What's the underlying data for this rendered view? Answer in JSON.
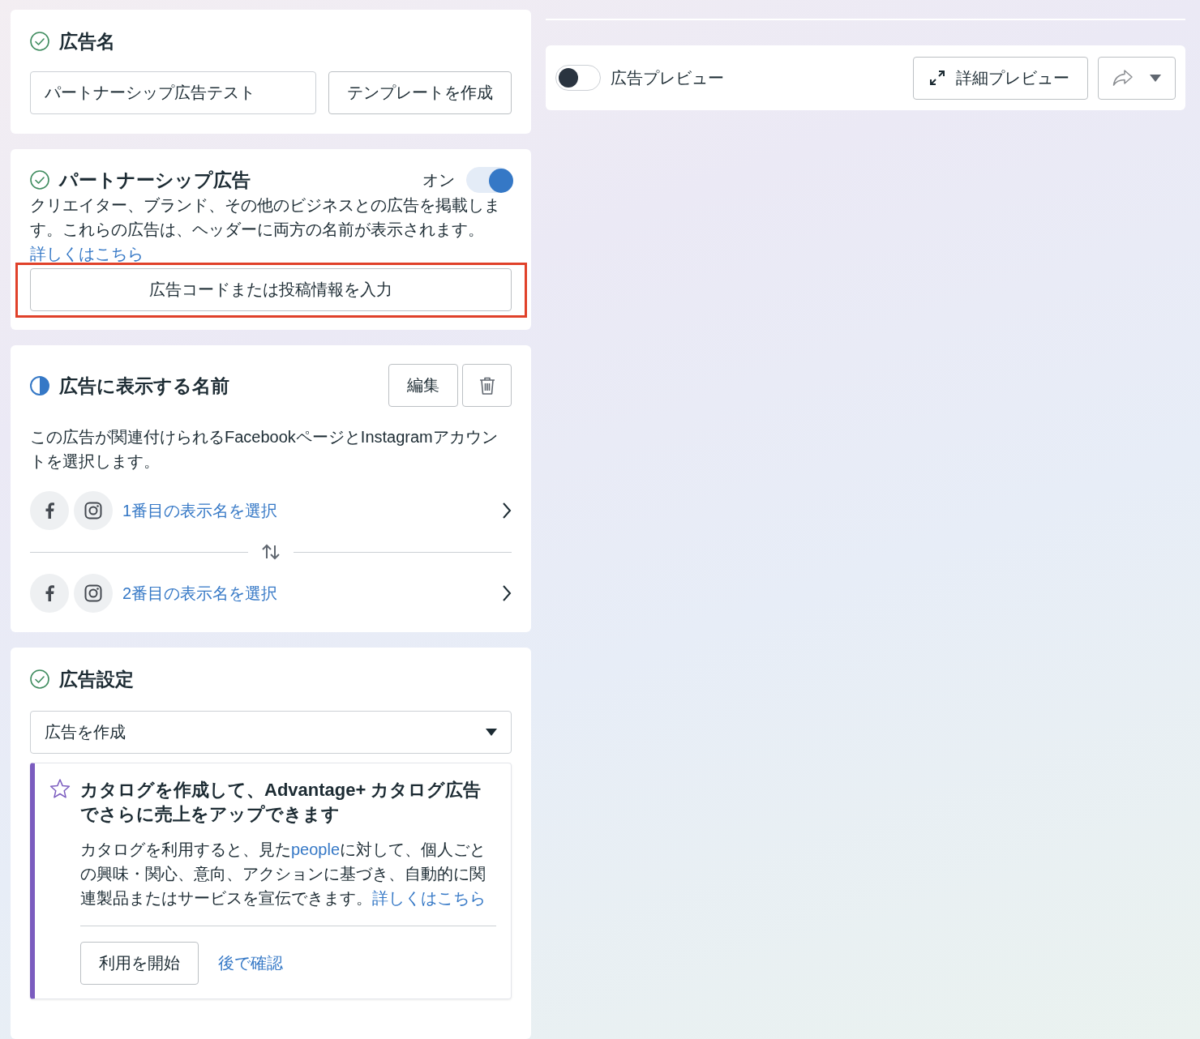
{
  "ad_name": {
    "kind": "complete",
    "title": "広告名",
    "value": "パートナーシップ広告テスト",
    "template_button": "テンプレートを作成"
  },
  "partnership": {
    "kind": "complete",
    "title": "パートナーシップ広告",
    "toggle_label": "オン",
    "on": true,
    "highlighted": true,
    "description": [
      {
        "kind": "text",
        "text": "クリエイター、ブランド、その他のビジネスとの広告を掲載します。これらの広告は、ヘッダーに両方の名前が表示されます。"
      },
      {
        "kind": "link",
        "text": "詳しくはこちら"
      }
    ],
    "code_button": "広告コードまたは投稿情報を入力"
  },
  "display_names": {
    "kind": "partial",
    "title": "広告に表示する名前",
    "edit_button": "編集",
    "description": "この広告が関連付けられるFacebookページとInstagramアカウントを選択します。",
    "identities": [
      {
        "label": "1番目の表示名を選択"
      },
      {
        "label": "2番目の表示名を選択"
      }
    ]
  },
  "ad_setup": {
    "kind": "complete",
    "title": "広告設定",
    "dropdown": {
      "value": "広告を作成"
    },
    "promo": {
      "title": "カタログを作成して、Advantage+ カタログ広告でさらに売上をアップできます",
      "body": [
        {
          "kind": "text",
          "text": "カタログを利用すると、見た"
        },
        {
          "kind": "link",
          "text": "people"
        },
        {
          "kind": "text",
          "text": "に対して、個人ごとの興味・関心、意向、アクションに基づき、自動的に関連製品またはサービスを宣伝できます。"
        },
        {
          "kind": "link",
          "text": "詳しくはこちら"
        }
      ],
      "primary_button": "利用を開始",
      "secondary_link": "後で確認"
    }
  },
  "preview": {
    "on": false,
    "label": "広告プレビュー",
    "detail_button": "詳細プレビュー"
  }
}
